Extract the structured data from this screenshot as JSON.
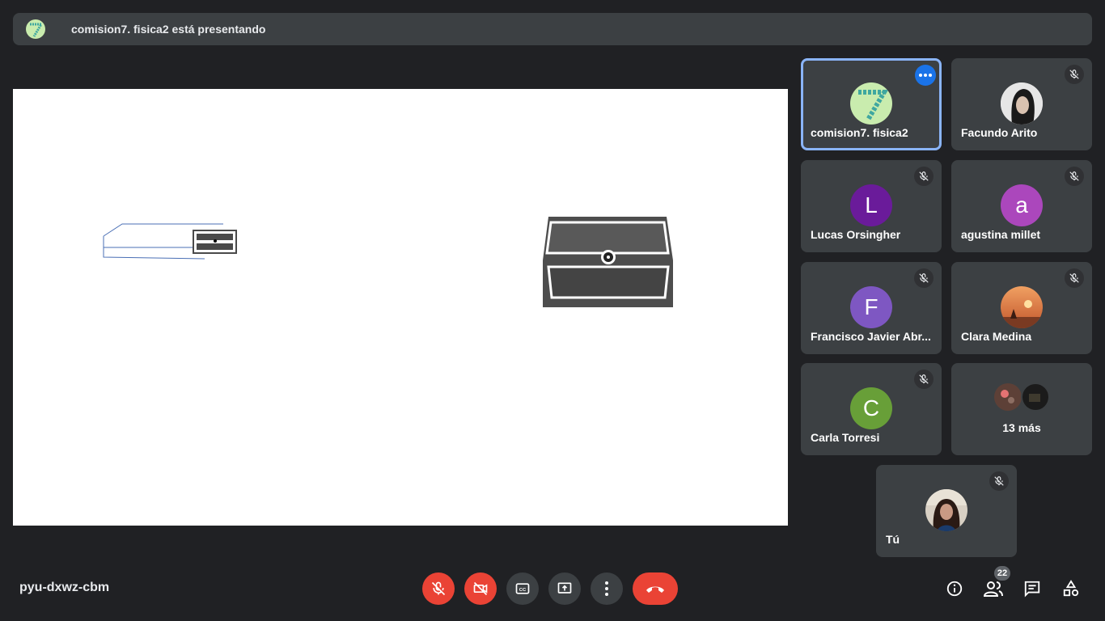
{
  "banner": {
    "title": "comision7. fisica2 está presentando",
    "avatar_icon": "number-seven-avatar"
  },
  "participants": [
    {
      "name": "comision7. fisica2",
      "avatar_type": "seven-logo",
      "avatar_color": "#c9ecae",
      "active": true,
      "has_more_menu": true
    },
    {
      "name": "Facundo Arito",
      "avatar_type": "photo",
      "muted": true
    },
    {
      "name": "Lucas Orsingher",
      "initial": "L",
      "avatar_color": "#6a1b9a",
      "muted": true
    },
    {
      "name": "agustina millet",
      "initial": "a",
      "avatar_color": "#ab47bc",
      "muted": true
    },
    {
      "name": "Francisco Javier Abr...",
      "initial": "F",
      "avatar_color": "#7e57c2",
      "muted": true
    },
    {
      "name": "Clara Medina",
      "avatar_type": "photo-sunset",
      "muted": true
    },
    {
      "name": "Carla Torresi",
      "initial": "C",
      "avatar_color": "#689f38",
      "muted": true
    },
    {
      "more_label": "13 más"
    },
    {
      "name": "Tú",
      "avatar_type": "photo",
      "muted": true
    }
  ],
  "toolbar": {
    "meeting_code": "pyu-dxwz-cbm",
    "people_count": "22",
    "mic_state": "off",
    "camera_state": "off",
    "colors": {
      "danger": "#ea4335",
      "surface": "#3c4043",
      "background": "#202124",
      "accent": "#1a73e8"
    }
  },
  "icons": {
    "mic": "mic-off-icon",
    "camera": "camera-off-icon",
    "captions": "captions-icon",
    "present": "present-screen-icon",
    "more": "more-vertical-icon",
    "hangup": "hangup-icon",
    "info": "info-icon",
    "people": "people-icon",
    "chat": "chat-icon",
    "activities": "activities-icon"
  }
}
